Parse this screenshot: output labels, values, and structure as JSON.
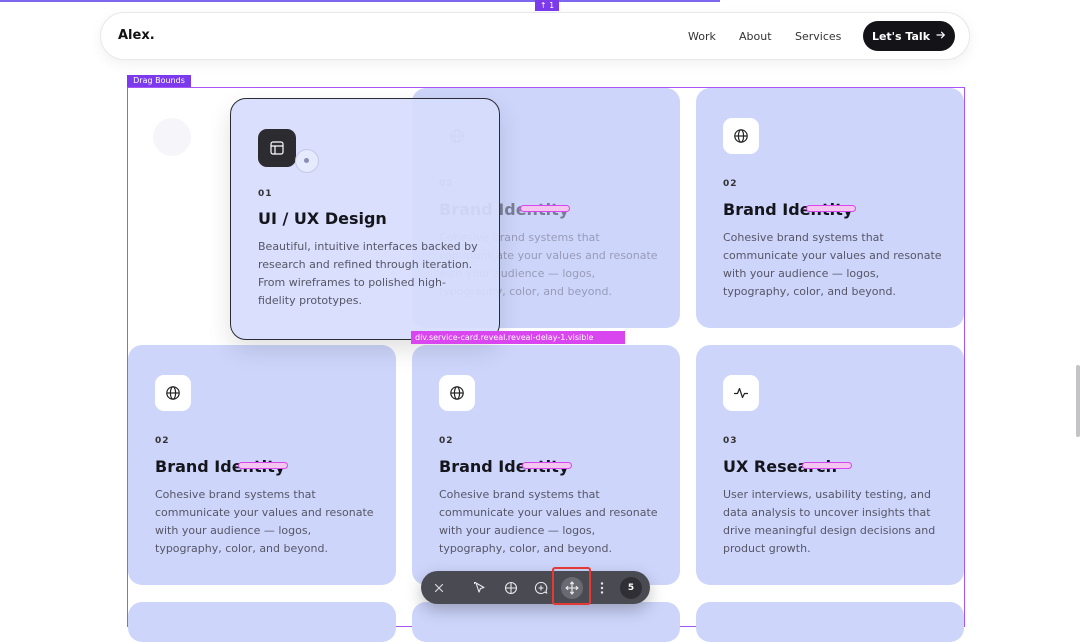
{
  "overlay": {
    "top_badge": "↑ 1",
    "drag_bounds_label": "Drag Bounds",
    "selection_tag": "div.service-card.reveal.reveal-delay-1.visible"
  },
  "nav": {
    "logo": "Alex.",
    "links": [
      "Work",
      "About",
      "Services"
    ],
    "cta": "Let's Talk",
    "cta_icon": "arrow-right-icon"
  },
  "dragged_card": {
    "number": "01",
    "title": "UI / UX Design",
    "description": "Beautiful, intuitive interfaces backed by research and refined through iteration. From wireframes to polished high-fidelity prototypes.",
    "icon": "layout-icon"
  },
  "cards": [
    {
      "number": "02",
      "title": "Brand Identity",
      "description": "Cohesive brand systems that communicate your values and resonate with your audience — logos, typography, color, and beyond.",
      "icon": "globe-icon"
    },
    {
      "number": "02",
      "title": "Brand Identity",
      "description": "Cohesive brand systems that communicate your values and resonate with your audience — logos, typography, color, and beyond.",
      "icon": "globe-icon"
    },
    {
      "number": "02",
      "title": "Brand Identity",
      "description": "Cohesive brand systems that communicate your values and resonate with your audience — logos, typography, color, and beyond.",
      "icon": "globe-icon"
    },
    {
      "number": "02",
      "title": "Brand Identity",
      "description": "Cohesive brand systems that communicate your values and resonate with your audience — logos, typography, color, and beyond.",
      "icon": "globe-icon"
    },
    {
      "number": "03",
      "title": "UX Research",
      "description": "User interviews, usability testing, and data analysis to uncover insights that drive meaningful design decisions and product growth.",
      "icon": "activity-icon"
    }
  ],
  "toolbar": {
    "tools": [
      "close-icon",
      "pointer-icon",
      "grid-icon",
      "add-comment-icon",
      "move-icon",
      "more-icon"
    ],
    "count": "5"
  },
  "colors": {
    "card_bg": "#cdd5fb",
    "accent_purple": "#7c3aed",
    "accent_magenta": "#d946ef",
    "dark": "#141418",
    "highlight_red": "#e53935"
  }
}
